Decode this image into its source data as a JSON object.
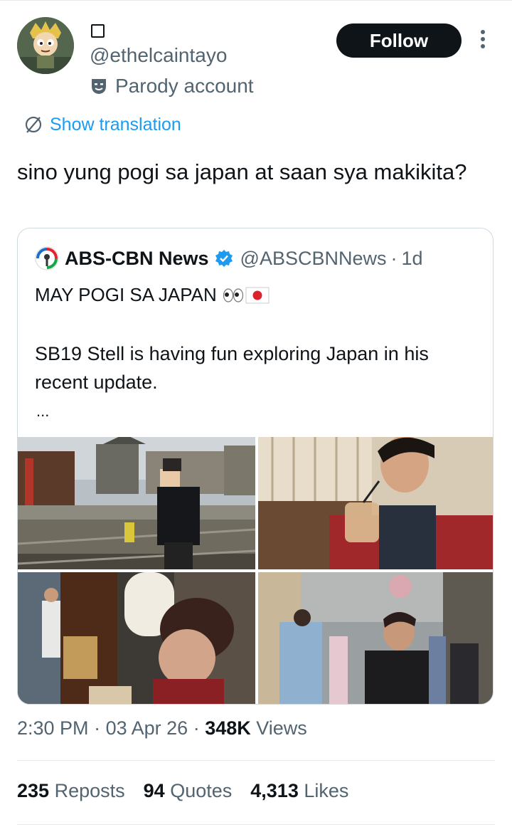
{
  "author": {
    "display_name_icon": "square-icon",
    "handle": "@ethelcaintayo",
    "parody_label": "Parody account"
  },
  "actions": {
    "follow_label": "Follow"
  },
  "translation": {
    "label": "Show translation"
  },
  "tweet": {
    "text": "sino yung pogi sa japan at saan sya makikita?",
    "time": "2:30 PM",
    "date": "03 Apr 26",
    "views_count": "348K",
    "views_label": "Views"
  },
  "quoted": {
    "source_name": "ABS-CBN News",
    "handle": "@ABSCBNNews",
    "separator": "·",
    "time_ago": "1d",
    "line1": "MAY POGI SA JAPAN",
    "line1_emoji": "👀🇯🇵",
    "body": "SB19 Stell is having fun exploring Japan in his recent update.",
    "truncation": "...",
    "photos": [
      {
        "name": "photo-train-platform"
      },
      {
        "name": "photo-drinking-coffee"
      },
      {
        "name": "photo-street-food-stall"
      },
      {
        "name": "photo-kimono-street"
      }
    ]
  },
  "stats": {
    "reposts_count": "235",
    "reposts_label": "Reposts",
    "quotes_count": "94",
    "quotes_label": "Quotes",
    "likes_count": "4,313",
    "likes_label": "Likes"
  },
  "colors": {
    "accent": "#1d9bf0",
    "text_primary": "#0f1419",
    "text_secondary": "#536471",
    "border": "#cfd9de"
  }
}
